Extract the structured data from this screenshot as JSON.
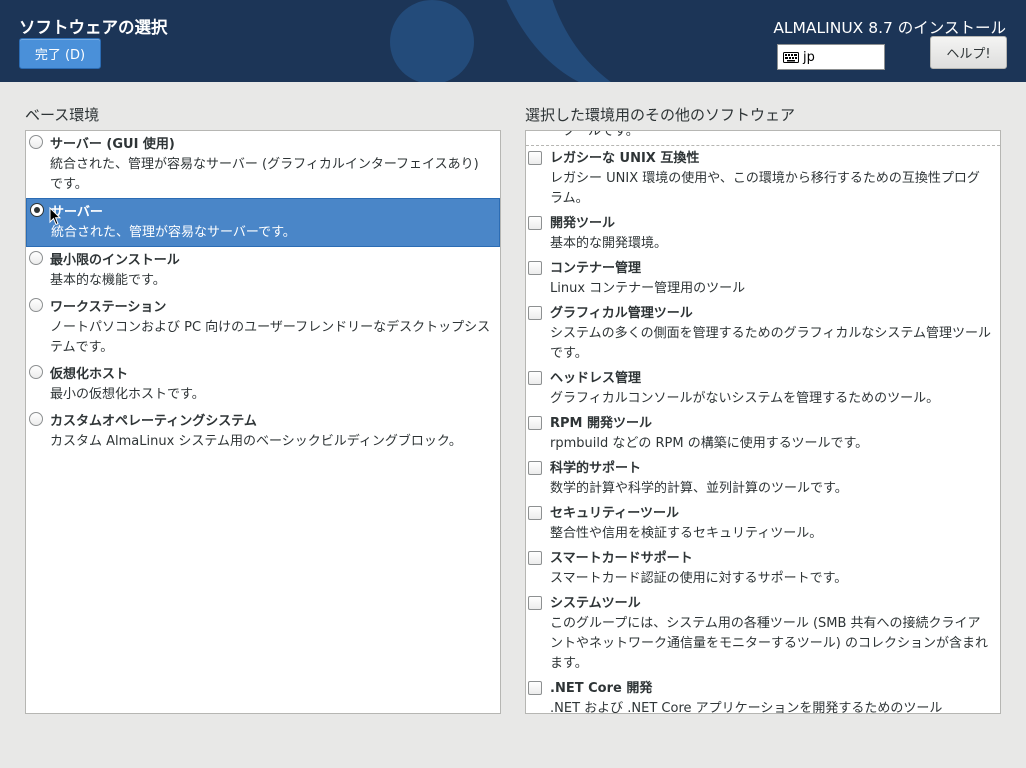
{
  "header": {
    "title": "ソフトウェアの選択",
    "done_label": "完了 (D)",
    "product_title": "ALMALINUX 8.7 のインストール",
    "keyboard_layout": "jp",
    "help_label": "ヘルプ!"
  },
  "base_env": {
    "label": "ベース環境",
    "items": [
      {
        "name": "サーバー (GUI 使用)",
        "desc": "統合された、管理が容易なサーバー (グラフィカルインターフェイスあり) です。",
        "selected": false
      },
      {
        "name": "サーバー",
        "desc": "統合された、管理が容易なサーバーです。",
        "selected": true
      },
      {
        "name": "最小限のインストール",
        "desc": "基本的な機能です。",
        "selected": false
      },
      {
        "name": "ワークステーション",
        "desc": "ノートパソコンおよび PC 向けのユーザーフレンドリーなデスクトップシステムです。",
        "selected": false
      },
      {
        "name": "仮想化ホスト",
        "desc": "最小の仮想化ホストです。",
        "selected": false
      },
      {
        "name": "カスタムオペレーティングシステム",
        "desc": "カスタム AlmaLinux システム用のベーシックビルディングブロック。",
        "selected": false
      }
    ]
  },
  "addons": {
    "label": "選択した環境用のその他のソフトウェア",
    "top_fragment": "ツールです。",
    "items": [
      {
        "name": "レガシーな UNIX 互換性",
        "desc": "レガシー UNIX 環境の使用や、この環境から移行するための互換性プログラム。"
      },
      {
        "name": "開発ツール",
        "desc": "基本的な開発環境。"
      },
      {
        "name": "コンテナー管理",
        "desc": "Linux コンテナー管理用のツール"
      },
      {
        "name": "グラフィカル管理ツール",
        "desc": "システムの多くの側面を管理するためのグラフィカルなシステム管理ツールです。"
      },
      {
        "name": "ヘッドレス管理",
        "desc": "グラフィカルコンソールがないシステムを管理するためのツール。"
      },
      {
        "name": "RPM 開発ツール",
        "desc": "rpmbuild などの RPM の構築に使用するツールです。"
      },
      {
        "name": "科学的サポート",
        "desc": "数学的計算や科学的計算、並列計算のツールです。"
      },
      {
        "name": "セキュリティーツール",
        "desc": "整合性や信用を検証するセキュリティツール。"
      },
      {
        "name": "スマートカードサポート",
        "desc": "スマートカード認証の使用に対するサポートです。"
      },
      {
        "name": "システムツール",
        "desc": "このグループには、システム用の各種ツール (SMB 共有への接続クライアントやネットワーク通信量をモニターするツール) のコレクションが含まれます。"
      },
      {
        "name": ".NET Core 開発",
        "desc": ".NET および .NET Core アプリケーションを開発するためのツール"
      }
    ]
  },
  "colors": {
    "header_bg": "#1c3557",
    "accent": "#4a90d9",
    "selection": "#4a86c8"
  },
  "icons": [
    "keyboard-icon",
    "mouse-cursor-icon",
    "almalinux-logo-art"
  ]
}
